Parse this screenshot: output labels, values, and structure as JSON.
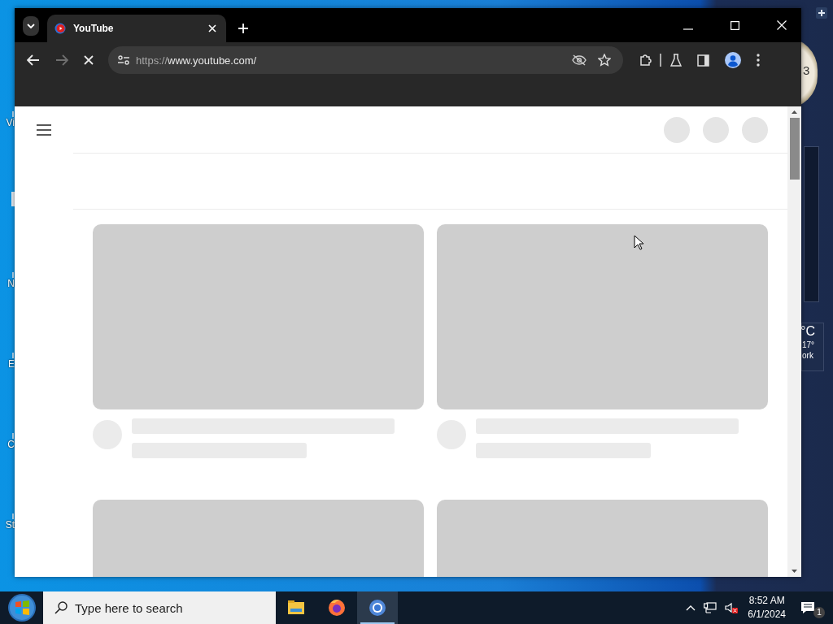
{
  "desktop": {
    "icons": [
      {
        "kind": "shortcut",
        "label": "Vi"
      },
      {
        "kind": "shortcut"
      },
      {
        "kind": "shortcut",
        "label": "N"
      },
      {
        "kind": "shortcut",
        "label": "E"
      },
      {
        "kind": "shortcut",
        "label": "C"
      },
      {
        "kind": "shortcut",
        "label": "St"
      }
    ],
    "clock_gadget": {
      "digit": "3"
    },
    "weather_gadget": {
      "temperature": "°C",
      "low": "17°",
      "location": "ork"
    }
  },
  "browser": {
    "tabs": [
      {
        "title": "YouTube",
        "selected": true
      }
    ],
    "navigation": {
      "back": {
        "disabled": false
      },
      "forward": {
        "disabled": true
      },
      "loading": true
    },
    "address_bar": {
      "scheme": "https://",
      "host": "www.youtube.com/"
    }
  },
  "taskbar": {
    "search": {
      "placeholder": "Type here to search"
    },
    "apps": [
      {
        "kind": "files",
        "selected": false
      },
      {
        "kind": "firefox",
        "selected": false
      },
      {
        "kind": "chrome",
        "selected": true
      }
    ],
    "time": "8:52 AM",
    "date": "6/1/2024",
    "notifications": "1"
  }
}
